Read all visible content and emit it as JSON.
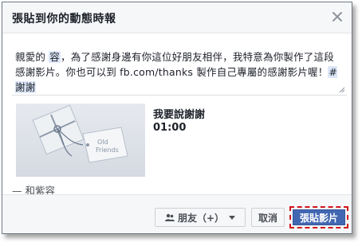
{
  "dialog": {
    "title": "張貼到你的動態時報",
    "message": {
      "part1": "親愛的",
      "mention": "容",
      "part2": "，為了感謝身邊有你這位好朋友相伴，我特意為你製作了這段感謝影片。你也可以到 fb.com/thanks 製作自己專屬的感謝影片喔！",
      "hashtag": "#謝謝"
    },
    "video": {
      "title": "我要說謝謝",
      "duration": "01:00",
      "thumb_tag": "Old Friends"
    },
    "credit": "— 和紫容",
    "footer": {
      "audience_label": "朋友（+）",
      "cancel_label": "取消",
      "share_label": "張貼影片"
    }
  },
  "colors": {
    "accent": "#4267b2",
    "highlight": "#d0131b"
  }
}
